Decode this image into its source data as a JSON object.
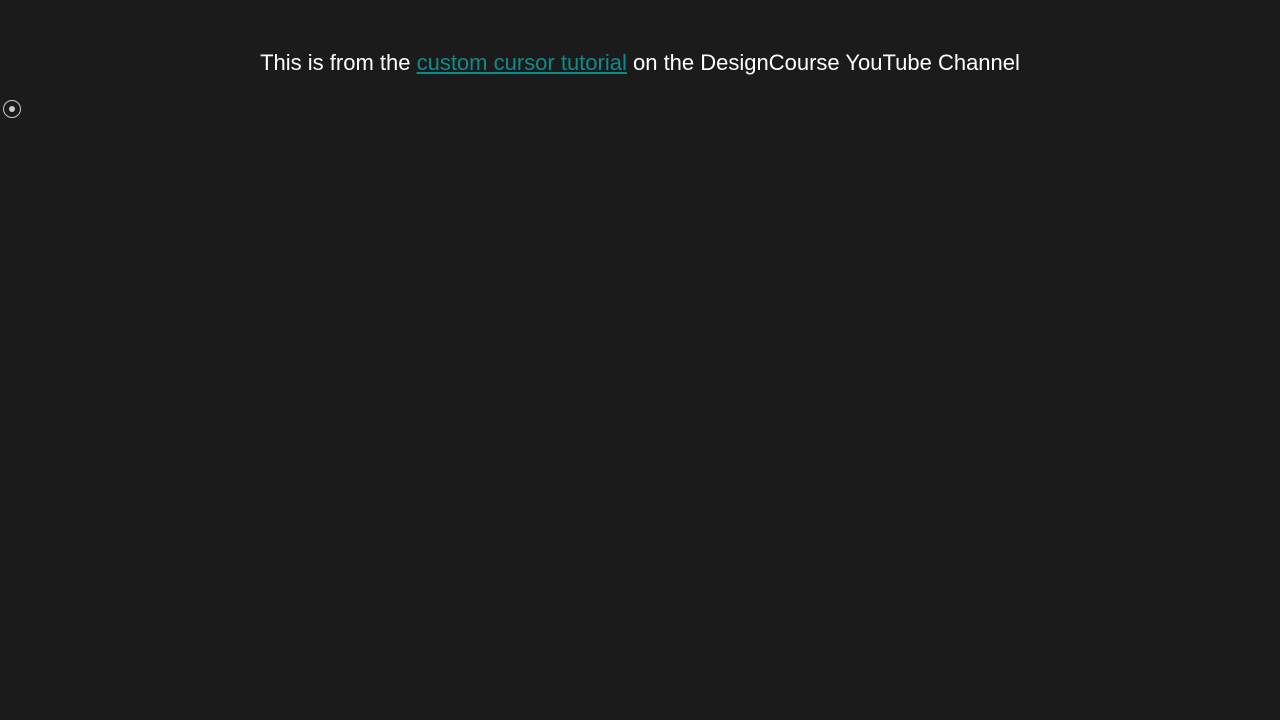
{
  "description": {
    "before_link": "This is from the ",
    "link_text": "custom cursor tutorial",
    "after_link": " on the DesignCourse YouTube Channel"
  },
  "colors": {
    "background": "#1b1b1b",
    "text": "#ffffff",
    "link": "#0d8b8b",
    "cursor": "#cccccc"
  }
}
